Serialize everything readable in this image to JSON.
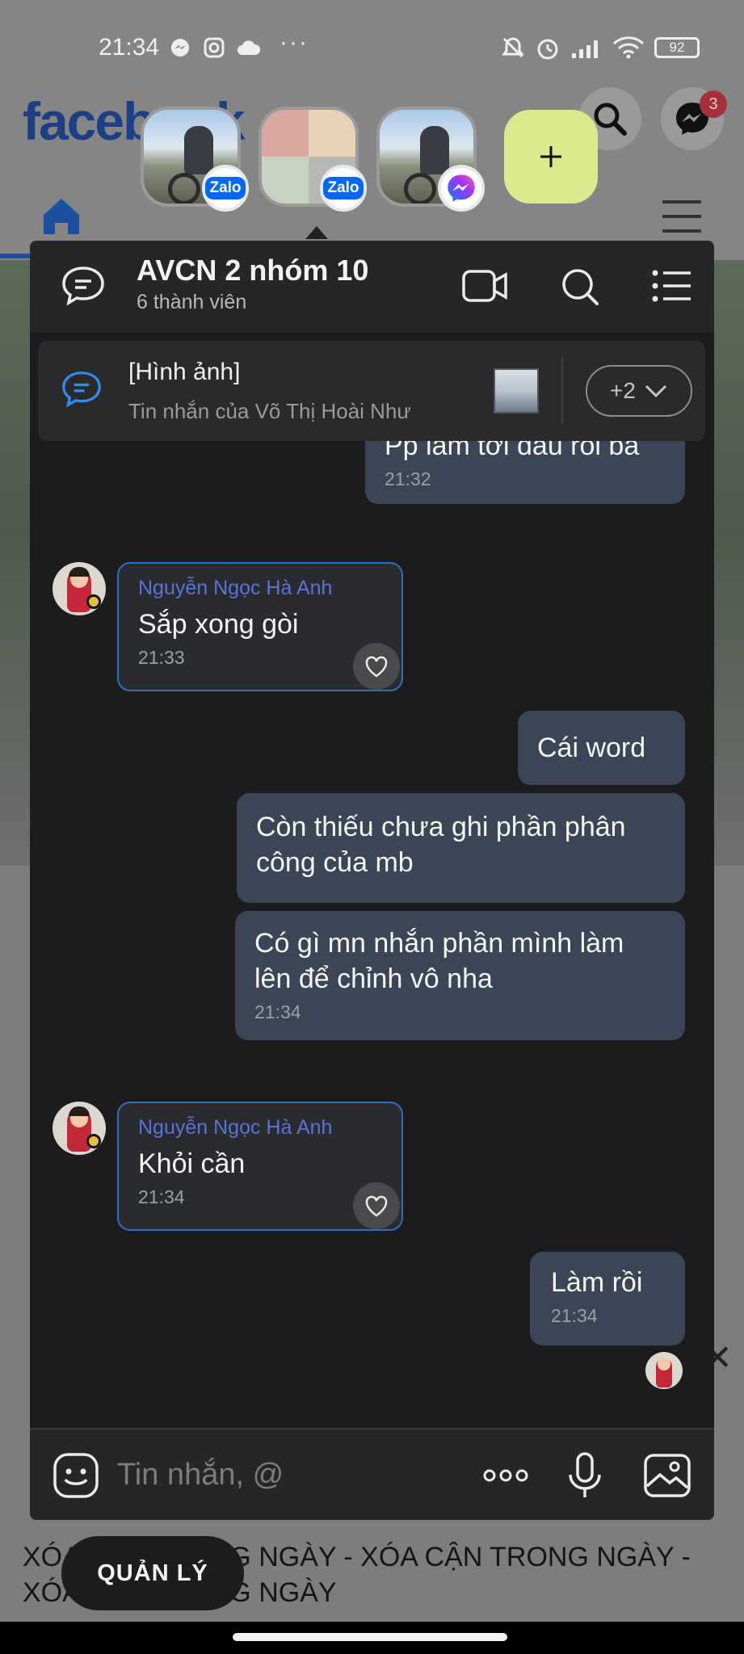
{
  "status_bar": {
    "time": "21:34",
    "battery": "92"
  },
  "facebook": {
    "logo": "facebook",
    "messenger_badge": "3",
    "post_text": "XÓA CẬN TRONG NGÀY - XÓA CẬN TRONG NGÀY - XÓA CẬN TRONG NGÀY"
  },
  "chat_heads": [
    {
      "app": "Zalo",
      "icon": "zalo-badge"
    },
    {
      "app": "Zalo",
      "icon": "zalo-badge"
    },
    {
      "app": "Messenger",
      "icon": "messenger-badge"
    }
  ],
  "chat": {
    "title": "AVCN 2 nhóm 10",
    "subtitle": "6 thành viên",
    "pinned": {
      "title": "[Hình ảnh]",
      "subtitle": "Tin nhắn của Võ Thị Hoài Như",
      "more": "+2"
    },
    "messages": [
      {
        "dir": "out",
        "text": "Pp làm tới đâu rồi bà",
        "time": "21:32"
      },
      {
        "dir": "in",
        "sender": "Nguyễn Ngọc Hà Anh",
        "text": "Sắp xong gòi",
        "time": "21:33"
      },
      {
        "dir": "out",
        "text": "Cái word"
      },
      {
        "dir": "out",
        "text": "Còn thiếu chưa ghi phần phân công của mb"
      },
      {
        "dir": "out",
        "text": "Có gì mn nhắn phần mình làm lên để chỉnh vô nha",
        "time": "21:34"
      },
      {
        "dir": "in",
        "sender": "Nguyễn Ngọc Hà Anh",
        "text": "Khỏi cần",
        "time": "21:34"
      },
      {
        "dir": "out",
        "text": "Làm rồi",
        "time": "21:34"
      }
    ],
    "composer_placeholder": "Tin nhắn, @"
  },
  "manage_button": "QUẢN LÝ",
  "colors": {
    "zalo_blue": "#0068ff",
    "outgoing_bubble": "#3b4555",
    "incoming_border": "#2e6fbd",
    "sender_name": "#5a73d6",
    "plus_button": "#dbe88b"
  }
}
